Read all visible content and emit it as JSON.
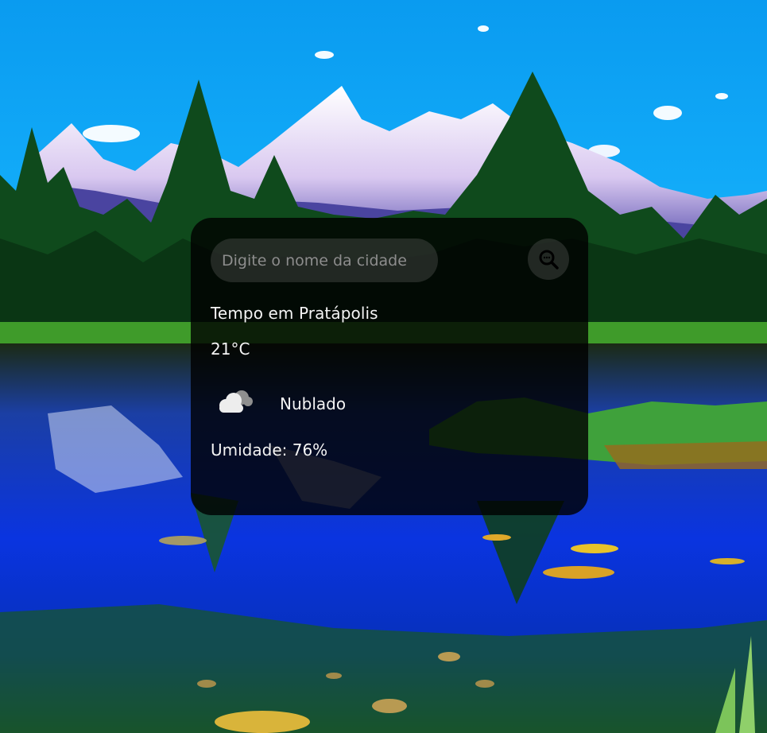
{
  "search": {
    "placeholder": "Digite o nome da cidade",
    "value": "",
    "button_icon": "magnifier-icon"
  },
  "weather": {
    "city_title": "Tempo em Pratápolis",
    "temperature": "21°C",
    "condition_icon": "cloud-icon",
    "description": "Nublado",
    "humidity": "Umidade: 76%"
  },
  "colors": {
    "card_background": "rgba(0,0,0,0.80)",
    "text": "#f4f4f4",
    "placeholder": "#8d8d8d"
  }
}
